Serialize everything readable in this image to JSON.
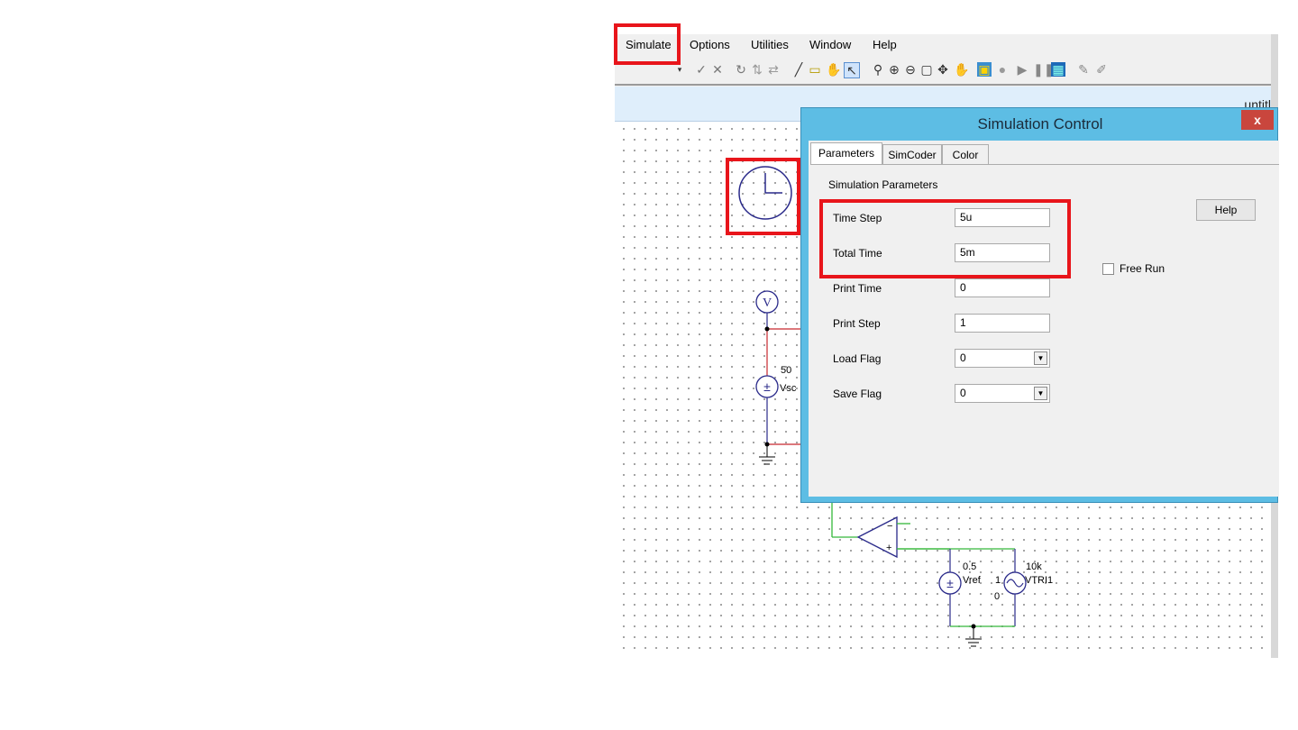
{
  "menubar": {
    "items": [
      "Simulate",
      "Options",
      "Utilities",
      "Window",
      "Help"
    ]
  },
  "toolbar": {
    "icons": [
      "dropdown-arrow-icon",
      "check-icon",
      "cross-icon",
      "rotate-icon",
      "flip-icon",
      "mirror-icon",
      "wire-icon",
      "label-icon",
      "hand-icon",
      "select-cursor-icon",
      "zoom-icon",
      "zoom-in-icon",
      "zoom-out-icon",
      "page-icon",
      "pan-icon",
      "drag-icon",
      "run-simcoder-icon",
      "stop-icon",
      "play-icon",
      "pause-icon",
      "simview-icon",
      "pencil-icon",
      "edit-icon"
    ]
  },
  "document": {
    "title": "untitl"
  },
  "schematic": {
    "voltmeter_label": "V",
    "vsource_value": "50",
    "vsource_name": "Vsc",
    "vref_value": "0.5",
    "vref_name": "Vref",
    "vtri_value": "10k",
    "vtri_name": "VTRI1",
    "vtri_param1": "1",
    "vtri_param2": "0"
  },
  "dialog": {
    "title": "Simulation Control",
    "close_label": "x",
    "tabs": [
      "Parameters",
      "SimCoder",
      "Color"
    ],
    "section_label": "Simulation Parameters",
    "help_label": "Help",
    "fields": [
      {
        "label": "Time Step",
        "value": "5u"
      },
      {
        "label": "Total Time",
        "value": "5m"
      },
      {
        "label": "Print Time",
        "value": "0"
      },
      {
        "label": "Print Step",
        "value": "1"
      }
    ],
    "combos": [
      {
        "label": "Load Flag",
        "value": "0"
      },
      {
        "label": "Save Flag",
        "value": "0"
      }
    ],
    "free_run_label": "Free Run",
    "free_run_checked": false
  },
  "highlight_color": "#e8151b"
}
